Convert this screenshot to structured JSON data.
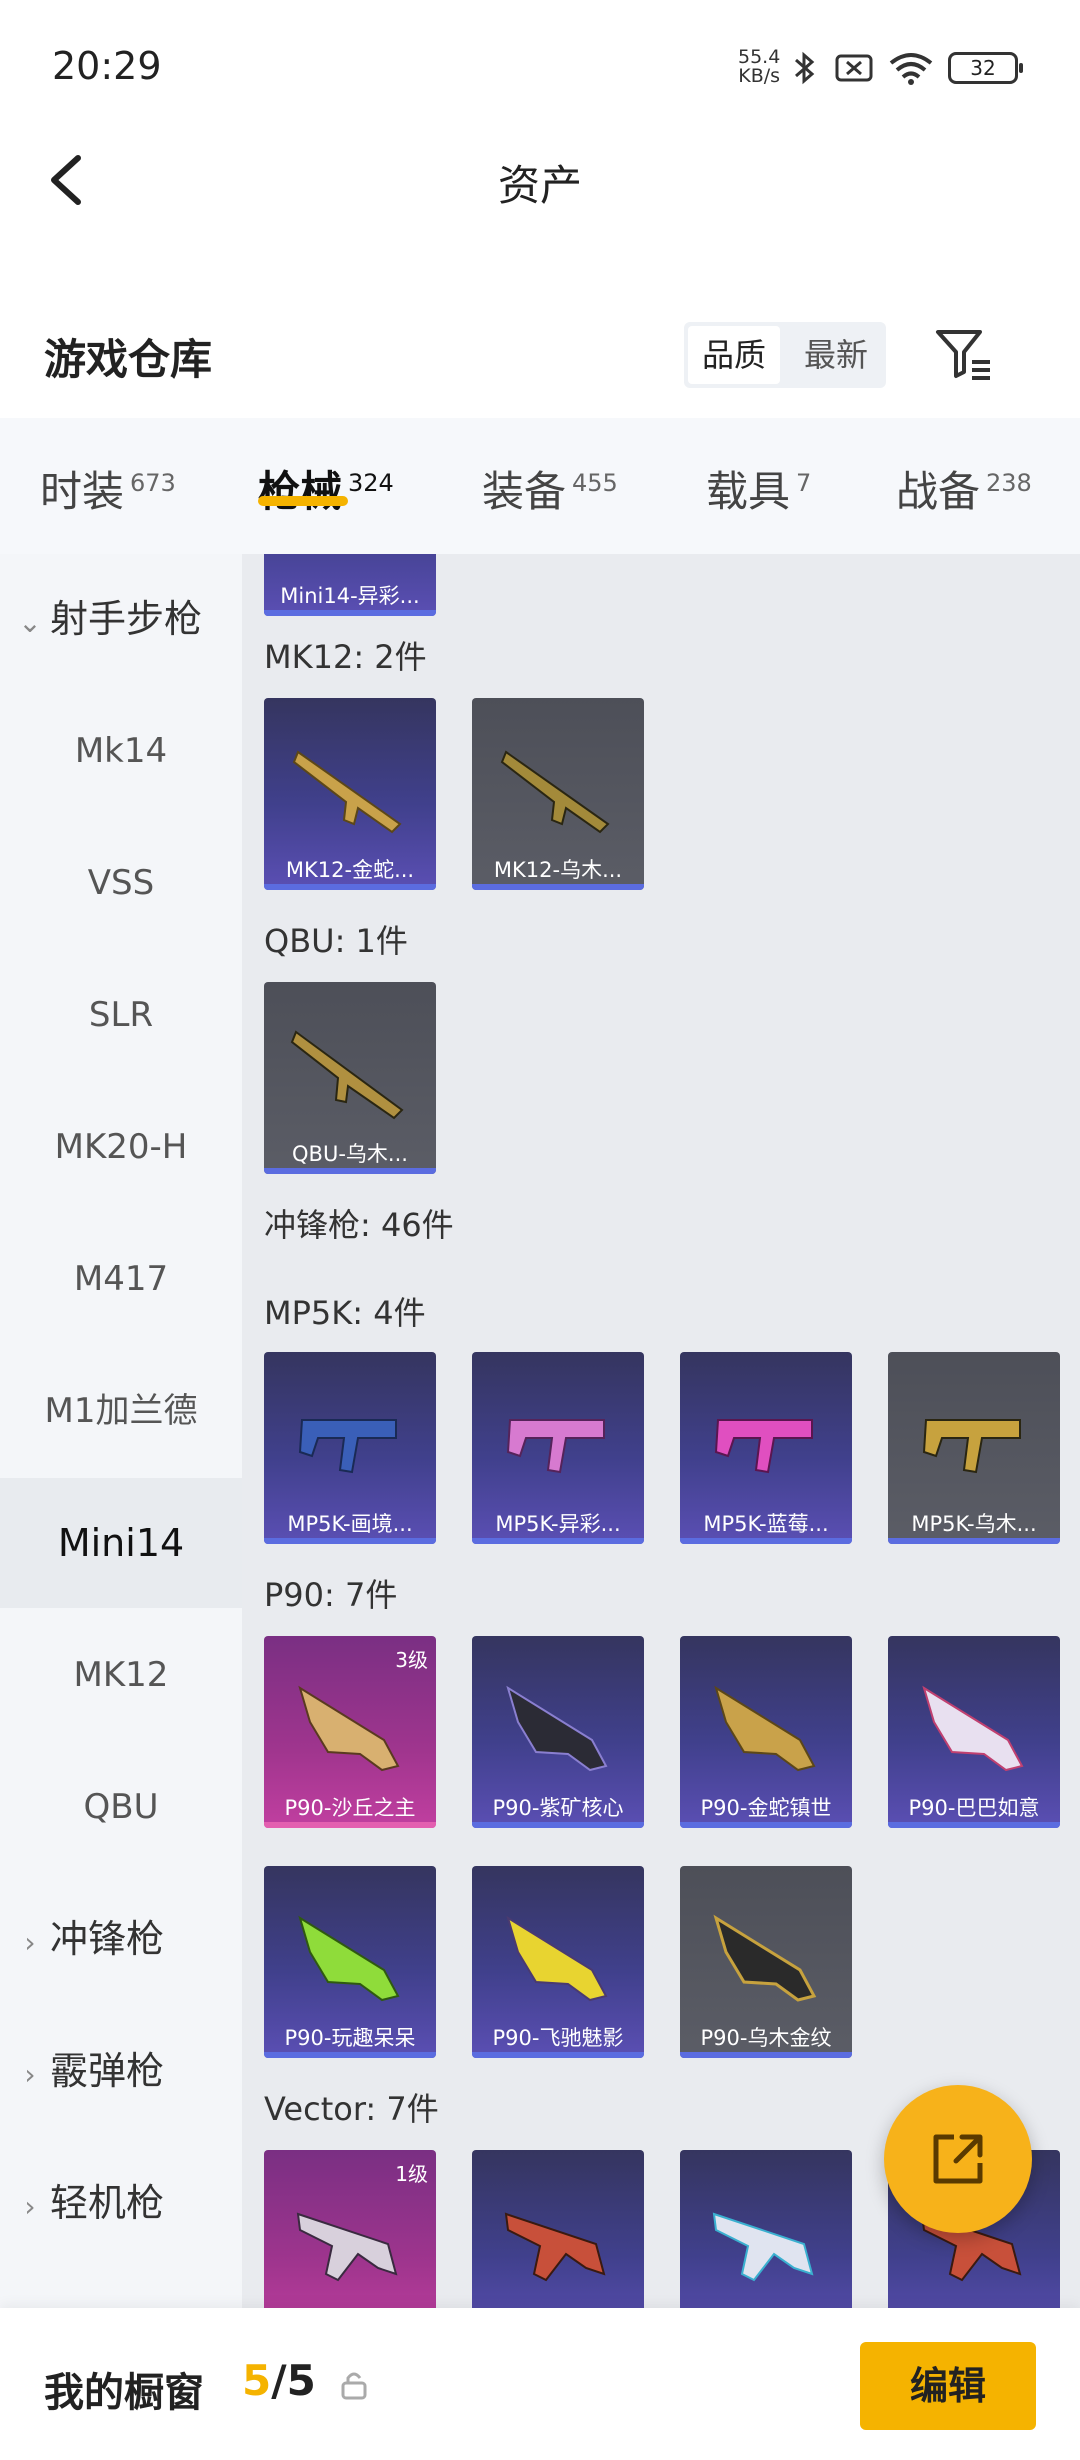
{
  "status_bar": {
    "time": "20:29",
    "net_speed_value": "55.4",
    "net_speed_unit": "KB/s",
    "battery": "32"
  },
  "header": {
    "title": "资产"
  },
  "warehouse": {
    "title": "游戏仓库",
    "sort_options": [
      "品质",
      "最新"
    ]
  },
  "tabs": [
    {
      "label": "时装",
      "count": "673"
    },
    {
      "label": "枪械",
      "count": "324"
    },
    {
      "label": "装备",
      "count": "455"
    },
    {
      "label": "载具",
      "count": "7"
    },
    {
      "label": "战备",
      "count": "238"
    }
  ],
  "sidebar": {
    "items": [
      {
        "label": "射手步枪",
        "group": true,
        "expanded": true
      },
      {
        "label": "Mk14"
      },
      {
        "label": "VSS"
      },
      {
        "label": "SLR"
      },
      {
        "label": "MK20-H"
      },
      {
        "label": "M417"
      },
      {
        "label": "M1加兰德"
      },
      {
        "label": "Mini14",
        "selected": true
      },
      {
        "label": "MK12"
      },
      {
        "label": "QBU"
      },
      {
        "label": "冲锋枪",
        "group": true
      },
      {
        "label": "霰弹枪",
        "group": true
      },
      {
        "label": "轻机枪",
        "group": true
      }
    ]
  },
  "content": {
    "top_card": {
      "name": "Mini14-异彩..."
    },
    "sections": [
      {
        "label": "MK12: 2件",
        "items": [
          {
            "name": "MK12-金蛇...",
            "style": "purple"
          },
          {
            "name": "MK12-乌木...",
            "style": "grey"
          }
        ]
      },
      {
        "label": "QBU: 1件",
        "items": [
          {
            "name": "QBU-乌木...",
            "style": "grey"
          }
        ]
      },
      {
        "label": "冲锋枪: 46件"
      },
      {
        "label": "MP5K: 4件",
        "items": [
          {
            "name": "MP5K-画境...",
            "style": "purple"
          },
          {
            "name": "MP5K-异彩...",
            "style": "purple"
          },
          {
            "name": "MP5K-蓝莓...",
            "style": "purple"
          },
          {
            "name": "MP5K-乌木...",
            "style": "grey"
          }
        ]
      },
      {
        "label": "P90: 7件",
        "items": [
          {
            "name": "P90-沙丘之主",
            "style": "pink",
            "level": "3级"
          },
          {
            "name": "P90-紫矿核心",
            "style": "purple"
          },
          {
            "name": "P90-金蛇镇世",
            "style": "purple"
          },
          {
            "name": "P90-巴巴如意",
            "style": "purple"
          },
          {
            "name": "P90-玩趣呆呆",
            "style": "purple"
          },
          {
            "name": "P90-飞驰魅影",
            "style": "purple"
          },
          {
            "name": "P90-乌木金纹",
            "style": "grey"
          }
        ]
      },
      {
        "label": "Vector: 7件",
        "items": [
          {
            "style": "pink",
            "level": "1级"
          },
          {
            "style": "purple"
          },
          {
            "style": "purple"
          },
          {
            "style": "purple"
          }
        ]
      }
    ]
  },
  "bottom_bar": {
    "label": "我的橱窗",
    "count_current": "5",
    "count_total": "/5",
    "edit_label": "编辑"
  },
  "colors": {
    "accent": "#f5b300",
    "rarity_purple": "#5b4fb4",
    "rarity_grey": "#5b5d66",
    "rarity_pink": "#c13fa0"
  }
}
